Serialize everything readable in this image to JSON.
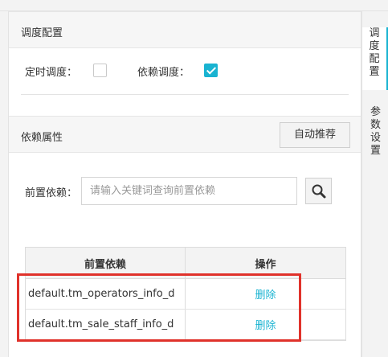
{
  "schedule_config": {
    "title": "调度配置",
    "timed_label": "定时调度：",
    "timed_checked": false,
    "dependency_label": "依赖调度：",
    "dependency_checked": true
  },
  "dependency_props": {
    "title": "依赖属性",
    "auto_recommend_label": "自动推荐",
    "pre_dependency_label": "前置依赖：",
    "search_placeholder": "请输入关键词查询前置依赖"
  },
  "table": {
    "headers": [
      "前置依赖",
      "操作"
    ],
    "rows": [
      {
        "name": "default.tm_operators_info_d",
        "action": "删除"
      },
      {
        "name": "default.tm_sale_staff_info_d",
        "action": "删除"
      }
    ]
  },
  "side_tabs": [
    {
      "chars": [
        "调",
        "度",
        "配",
        "置"
      ],
      "active": true
    },
    {
      "chars": [
        "参",
        "数",
        "设",
        "置"
      ],
      "active": false
    }
  ],
  "colors": {
    "accent": "#19b3d1",
    "highlight": "#e0322b"
  },
  "icons": {
    "search": "search-icon",
    "check": "checkmark-icon"
  }
}
